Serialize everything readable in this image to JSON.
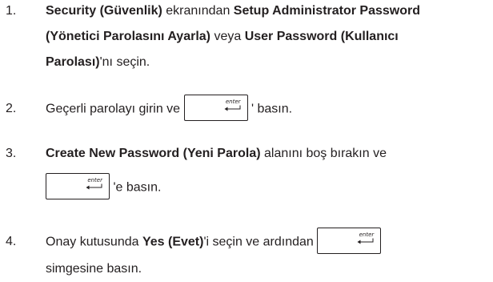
{
  "enter_key_label": "enter",
  "steps": [
    {
      "number": "1.",
      "line1": {
        "b1": "Security (Güvenlik)",
        "t1": " ekranından ",
        "b2": "Setup Administrator Password"
      },
      "line2": {
        "b1": "(Yönetici Parolasını Ayarla)",
        "t1": " veya ",
        "b2": "User Password (Kullanıcı"
      },
      "line3": {
        "b1": "Parolası)",
        "t1": "'nı seçin."
      }
    },
    {
      "number": "2.",
      "before_key": "Geçerli parolayı girin ve ",
      "after_key": " ' basın."
    },
    {
      "number": "3.",
      "line1": {
        "b1": "Create New Password (Yeni Parola)",
        "t1": " alanını boş bırakın ve"
      },
      "after_key": " 'e basın."
    },
    {
      "number": "4.",
      "line1": {
        "t1": "Onay kutusunda ",
        "b1": "Yes (Evet)",
        "t2": "'i seçin ve ardından "
      },
      "line2": "simgesine basın."
    }
  ]
}
